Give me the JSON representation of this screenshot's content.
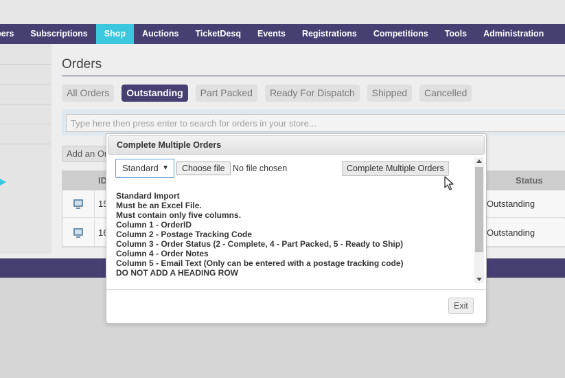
{
  "nav": {
    "items": [
      {
        "label": "bers"
      },
      {
        "label": "Subscriptions"
      },
      {
        "label": "Shop",
        "active": true
      },
      {
        "label": "Auctions"
      },
      {
        "label": "TicketDesq"
      },
      {
        "label": "Events"
      },
      {
        "label": "Registrations"
      },
      {
        "label": "Competitions"
      },
      {
        "label": "Tools"
      },
      {
        "label": "Administration"
      }
    ]
  },
  "page": {
    "title": "Orders",
    "tabs": [
      {
        "label": "All Orders",
        "active": false
      },
      {
        "label": "Outstanding",
        "active": true
      },
      {
        "label": "Part Packed",
        "active": false
      },
      {
        "label": "Ready For Dispatch",
        "active": false
      },
      {
        "label": "Shipped",
        "active": false
      },
      {
        "label": "Cancelled",
        "active": false
      }
    ],
    "search_placeholder": "Type here then press enter to search for orders in your store...",
    "add_order_label": "Add an Order"
  },
  "table": {
    "id_header": "ID",
    "status_header": "Status",
    "rows": [
      {
        "id": "15",
        "status": "Outstanding"
      },
      {
        "id": "16",
        "status": "Outstanding"
      }
    ]
  },
  "modal": {
    "title": "Complete Multiple Orders",
    "select_value": "Standard",
    "choose_file_label": "Choose file",
    "file_status": "No file chosen",
    "complete_label": "Complete Multiple Orders",
    "instructions": [
      "Standard Import",
      "Must be an Excel File.",
      "Must contain only five columns.",
      "Column 1 - OrderID",
      "Column 2 - Postage Tracking Code",
      "Column 3 - Order Status (2 - Complete, 4 - Part Packed, 5 - Ready to Ship)",
      "Column 4 - Order Notes",
      "Column 5 - Email Text (Only can be entered with a postage tracking code)",
      "DO NOT ADD A HEADING ROW"
    ],
    "exit_label": "Exit"
  },
  "colors": {
    "nav_bg": "#463f72",
    "nav_active": "#3bc8de",
    "tab_active": "#463f72"
  }
}
